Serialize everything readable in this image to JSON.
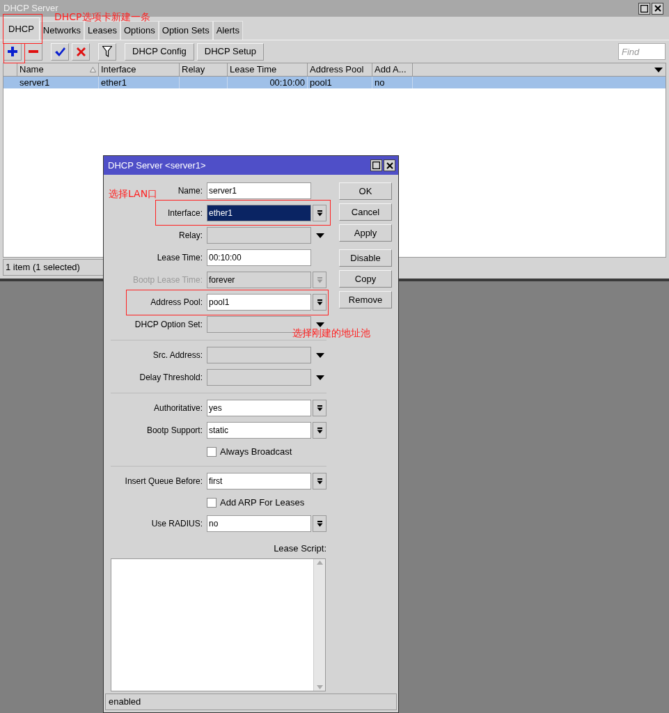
{
  "main_window": {
    "title": "DHCP Server",
    "tabs": [
      {
        "label": "DHCP",
        "selected": true
      },
      {
        "label": "Networks",
        "selected": false
      },
      {
        "label": "Leases",
        "selected": false
      },
      {
        "label": "Options",
        "selected": false
      },
      {
        "label": "Option Sets",
        "selected": false
      },
      {
        "label": "Alerts",
        "selected": false
      }
    ],
    "toolbar": {
      "icon_buttons": [
        {
          "kind": "add"
        },
        {
          "kind": "remove"
        },
        {
          "kind": "enable"
        },
        {
          "kind": "disable"
        },
        {
          "kind": "filter"
        }
      ],
      "buttons": [
        "DHCP Config",
        "DHCP Setup"
      ],
      "find": {
        "placeholder": "Find"
      }
    },
    "table": {
      "columns": [
        {
          "label": "Name",
          "sorted": true
        },
        {
          "label": "Interface",
          "sorted": false
        },
        {
          "label": "Relay",
          "sorted": false
        },
        {
          "label": "Lease Time",
          "sorted": false
        },
        {
          "label": "Address Pool",
          "sorted": false
        },
        {
          "label": "Add A...",
          "sorted": false
        }
      ],
      "rows": [
        {
          "selected": true,
          "cells": [
            "server1",
            "ether1",
            "",
            "00:10:00",
            "pool1",
            "no"
          ]
        }
      ]
    },
    "status_bar": "1 item (1 selected)"
  },
  "dialog": {
    "title": "DHCP Server <server1>",
    "fields": [
      {
        "kind": "text",
        "label": "Name:",
        "value": "server1",
        "disabled": false,
        "focused": false
      },
      {
        "kind": "combo",
        "label": "Interface:",
        "value": "ether1",
        "disabled": false,
        "focused": true
      },
      {
        "kind": "dropdown",
        "label": "Relay:"
      },
      {
        "kind": "text",
        "label": "Lease Time:",
        "value": "00:10:00",
        "disabled": false,
        "focused": false
      },
      {
        "kind": "combo",
        "label": "Bootp Lease Time:",
        "value": "forever",
        "disabled": true,
        "focused": false
      },
      {
        "kind": "combo",
        "label": "Address Pool:",
        "value": "pool1",
        "disabled": false,
        "focused": false
      },
      {
        "kind": "dropdown",
        "label": "DHCP Option Set:"
      },
      {
        "kind": "separator"
      },
      {
        "kind": "dropdown",
        "label": "Src. Address:"
      },
      {
        "kind": "dropdown",
        "label": "Delay Threshold:"
      },
      {
        "kind": "separator"
      },
      {
        "kind": "combo",
        "label": "Authoritative:",
        "value": "yes",
        "disabled": false,
        "focused": false
      },
      {
        "kind": "combo",
        "label": "Bootp Support:",
        "value": "static",
        "disabled": false,
        "focused": false
      },
      {
        "kind": "checkbox",
        "label": "Always Broadcast",
        "checked": false
      },
      {
        "kind": "separator"
      },
      {
        "kind": "combo",
        "label": "Insert Queue Before:",
        "value": "first",
        "disabled": false,
        "focused": false
      },
      {
        "kind": "checkbox",
        "label": "Add ARP For Leases",
        "checked": false
      },
      {
        "kind": "combo",
        "label": "Use RADIUS:",
        "value": "no",
        "disabled": false,
        "focused": false
      }
    ],
    "script_label": "Lease Script:",
    "button_groups": [
      [
        "OK",
        "Cancel",
        "Apply"
      ],
      [
        "Disable",
        "Copy",
        "Remove"
      ]
    ],
    "status_bar": "enabled"
  },
  "annotations": [
    {
      "text": "DHCP选项卡新建一条"
    },
    {
      "text": "选择LAN口"
    },
    {
      "text": "选择刚建的地址池"
    }
  ]
}
